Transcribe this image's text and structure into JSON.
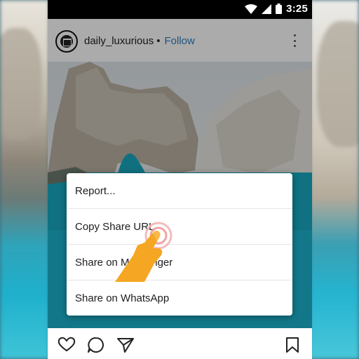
{
  "status_bar": {
    "time": "3:25",
    "icons": [
      "wifi-icon",
      "signal-icon",
      "battery-icon"
    ]
  },
  "post": {
    "username": "daily_luxurious",
    "separator": "•",
    "follow_label": "Follow"
  },
  "menu": {
    "items": [
      {
        "label": "Report..."
      },
      {
        "label": "Copy Share URL"
      },
      {
        "label": "Share on Messenger"
      },
      {
        "label": "Share on WhatsApp"
      }
    ]
  },
  "actions": [
    "heart-icon",
    "comment-icon",
    "share-icon",
    "bookmark-icon"
  ],
  "colors": {
    "follow": "#2f7dbd",
    "hand": "#f5a623",
    "tap_ring": "#f0a0a0"
  }
}
